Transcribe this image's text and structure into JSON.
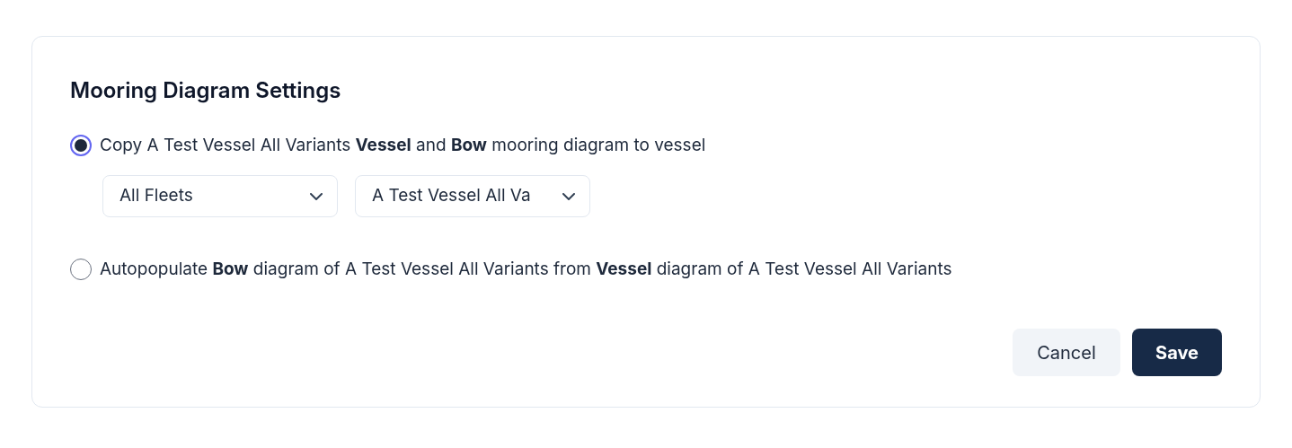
{
  "dialog": {
    "title": "Mooring Diagram Settings",
    "options": [
      {
        "label": "Copy A Test Vessel All Variants **Vessel** and **Bow** mooring diagram to vessel",
        "selected": true,
        "dropdowns": [
          {
            "value": "All Fleets"
          },
          {
            "value": "A Test Vessel All Va"
          }
        ]
      },
      {
        "label": "Autopopulate **Bow** diagram of A Test Vessel All Variants from **Vessel** diagram of A Test Vessel All Variants",
        "selected": false
      }
    ],
    "buttons": [
      {
        "label": "Cancel",
        "kind": "secondary"
      },
      {
        "label": "Save",
        "kind": "primary"
      }
    ]
  }
}
